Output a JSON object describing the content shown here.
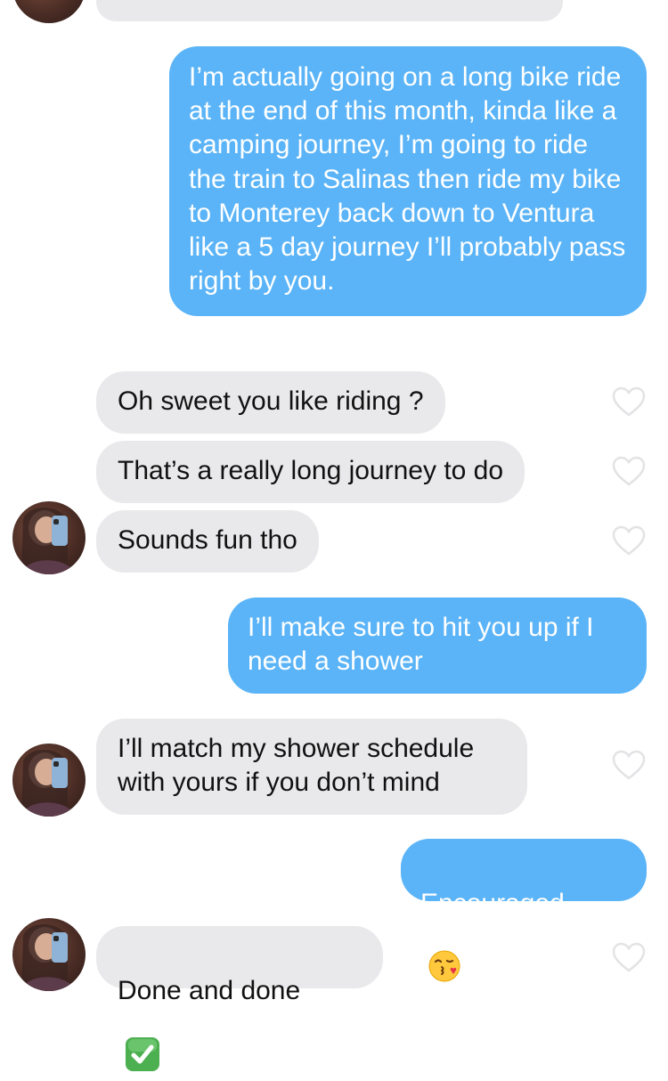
{
  "messages": {
    "out_1": "I’m actually going on a long bike ride at the end of this month, kinda like a camping journey, I’m going to ride the train to Salinas then ride my bike to Monterey back down to Ventura like a 5 day journey I’ll probably pass right by you.",
    "in_1": "Oh sweet you like riding ?",
    "in_2": "That’s a really long journey to do",
    "in_3": "Sounds fun tho",
    "out_2": "I’ll make sure to hit you up if I need a shower",
    "in_4": "I’ll match my shower schedule with yours if you don’t mind",
    "out_3": "Encouraged",
    "in_5": "Done and done"
  },
  "icons": {
    "like": "heart-outline-icon",
    "kiss_emoji": "face-blowing-kiss-emoji",
    "check_emoji": "check-mark-button-emoji"
  },
  "colors": {
    "outgoing_bubble": "#5bb4f7",
    "incoming_bubble": "#e9e9eb",
    "heart_outline": "#e3e3e6"
  }
}
